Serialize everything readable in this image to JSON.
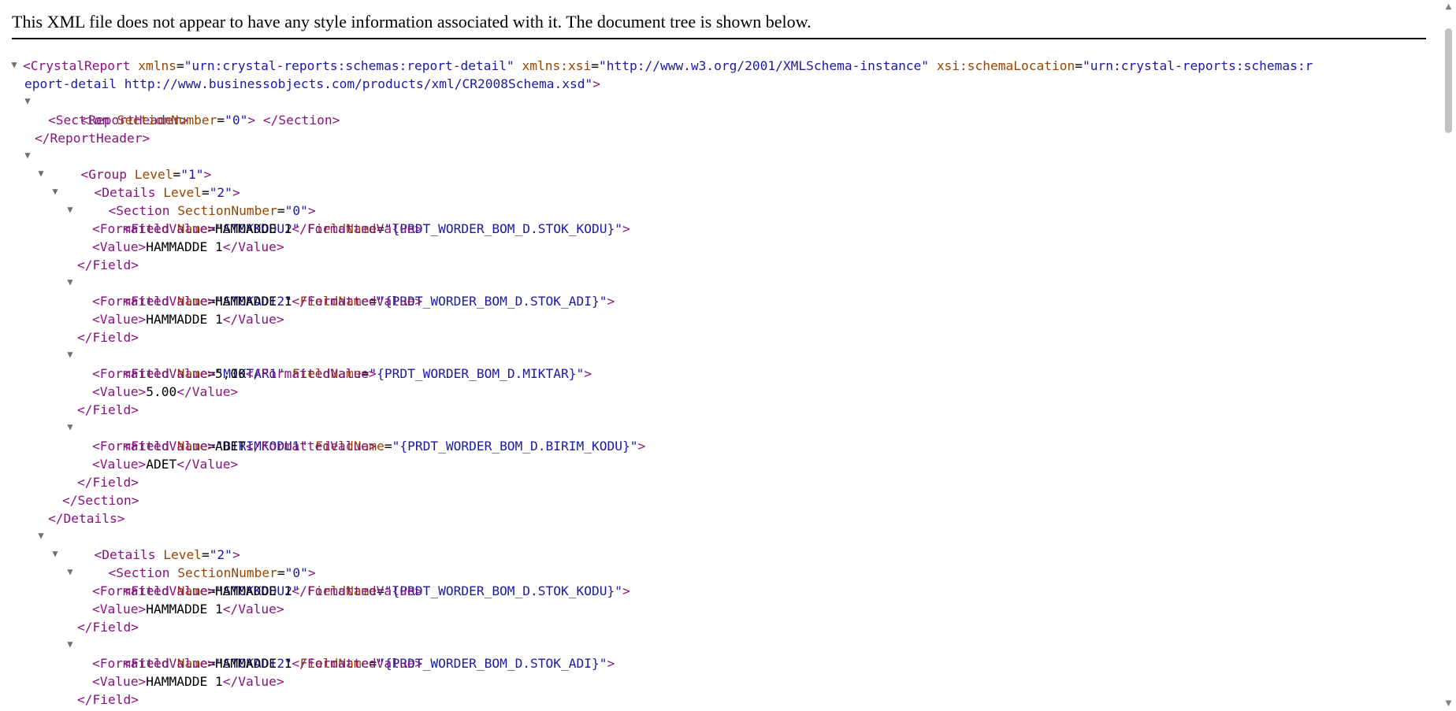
{
  "info_message": "This XML file does not appear to have any style information associated with it. The document tree is shown below.",
  "tree": {
    "line1": {
      "open": "<CrystalReport",
      "a1": "xmlns",
      "v1": "\"urn:crystal-reports:schemas:report-detail\"",
      "a2": "xmlns:xsi",
      "v2": "\"http://www.w3.org/2001/XMLSchema-instance\"",
      "a3": "xsi:schemaLocation",
      "v3": "\"urn:crystal-reports:schemas:report-detail http://www.businessobjects.com/products/xml/CR2008Schema.xsd\"",
      "close": ">"
    },
    "reportheader_open": "<ReportHeader>",
    "section0": {
      "open": "<Section",
      "attr": "SectionNumber",
      "val": "\"0\"",
      "mid": ">",
      "close": " </Section>"
    },
    "reportheader_close": "</ReportHeader>",
    "group_open": {
      "open": "<Group",
      "attr": "Level",
      "val": "\"1\"",
      "close": ">"
    },
    "details_open": {
      "open": "<Details",
      "attr": "Level",
      "val": "\"2\"",
      "close": ">"
    },
    "section_open": {
      "open": "<Section",
      "attr": "SectionNumber",
      "val": "\"0\"",
      "close": ">"
    },
    "fields": [
      {
        "name": "\"STOKKODU2\"",
        "fieldname": "\"{PRDT_WORDER_BOM_D.STOK_KODU}\"",
        "formatted": "HAMMADDE 1",
        "value": "HAMMADDE 1"
      },
      {
        "name": "\"STOKADI2\"",
        "fieldname": "\"{PRDT_WORDER_BOM_D.STOK_ADI}\"",
        "formatted": "HAMMADDE 1",
        "value": "HAMMADDE 1"
      },
      {
        "name": "\"MIKTAR1\"",
        "fieldname": "\"{PRDT_WORDER_BOM_D.MIKTAR}\"",
        "formatted": "5,00",
        "value": "5.00"
      },
      {
        "name": "\"BIRIMKODU1\"",
        "fieldname": "\"{PRDT_WORDER_BOM_D.BIRIM_KODU}\"",
        "formatted": "ADET",
        "value": "ADET"
      }
    ],
    "fields2": [
      {
        "name": "\"STOKKODU2\"",
        "fieldname": "\"{PRDT_WORDER_BOM_D.STOK_KODU}\"",
        "formatted": "HAMMADDE 1",
        "value": "HAMMADDE 1"
      },
      {
        "name": "\"STOKADI2\"",
        "fieldname": "\"{PRDT_WORDER_BOM_D.STOK_ADI}\"",
        "formatted": "HAMMADDE 1",
        "value": "HAMMADDE 1"
      }
    ],
    "tags": {
      "field_open": "<Field",
      "name_attr": "Name",
      "fieldname_attr": "FieldName",
      "gt": ">",
      "fv_open": "<FormattedValue>",
      "fv_close": "</FormattedValue>",
      "v_open": "<Value>",
      "v_close": "</Value>",
      "field_close": "</Field>",
      "section_close": "</Section>",
      "details_close": "</Details>"
    }
  },
  "icons": {
    "expanded": "▼",
    "scroll_up": "▲",
    "scroll_down": "▼"
  },
  "colors": {
    "tag": "#881280",
    "attr_name": "#994500",
    "attr_value": "#1a1aa6",
    "text": "#000000",
    "toggle": "#6e6e6e"
  }
}
